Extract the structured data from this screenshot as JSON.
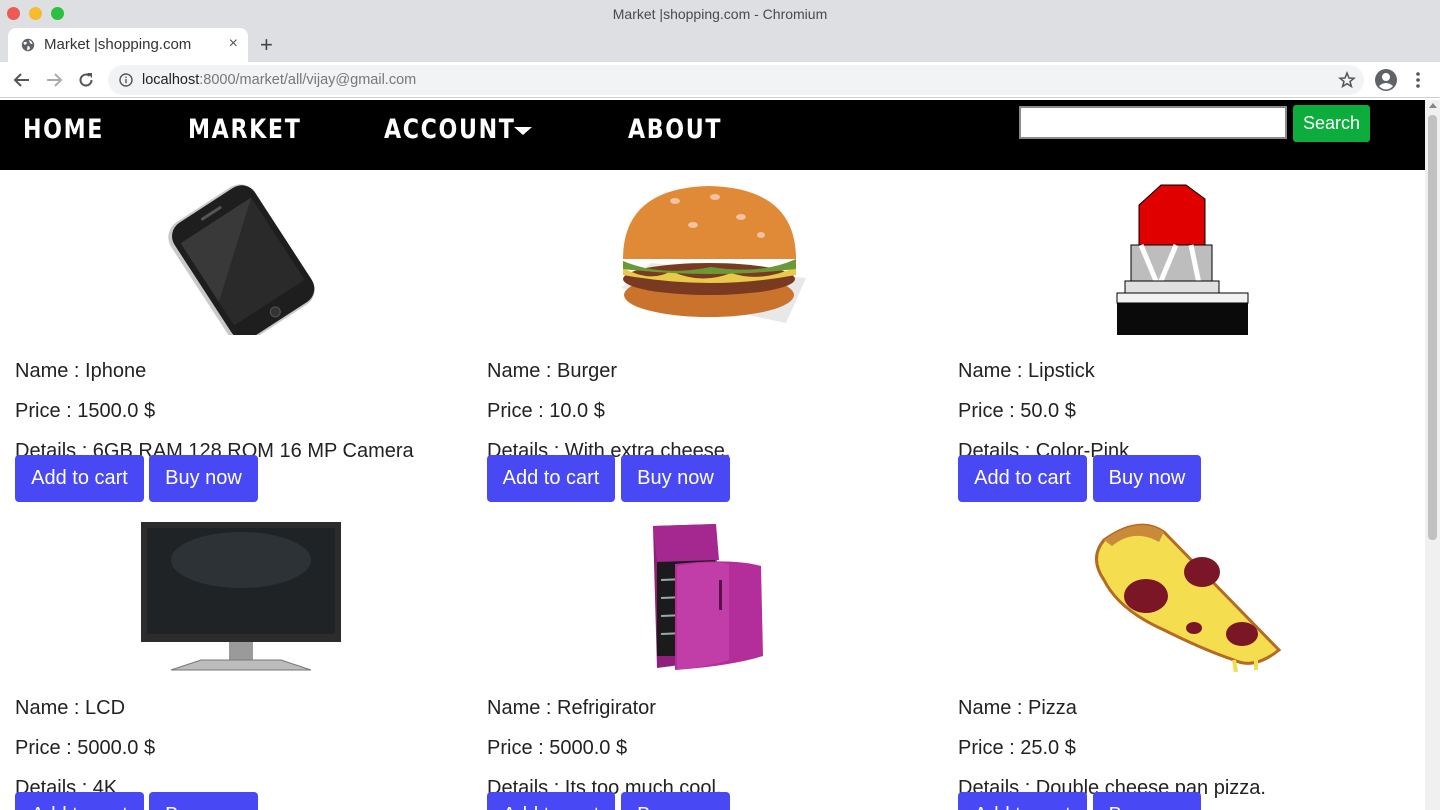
{
  "window": {
    "title": "Market |shopping.com - Chromium"
  },
  "tab": {
    "title": "Market |shopping.com",
    "close": "×",
    "new_tab": "+"
  },
  "address": {
    "host": "localhost",
    "path": ":8000/market/all/vijay@gmail.com"
  },
  "navbar": {
    "links": [
      "HOME",
      "MARKET",
      "ACCOUNT",
      "ABOUT"
    ],
    "search_value": "",
    "search_button": "Search"
  },
  "products": [
    {
      "name": "Name : Iphone",
      "price": "Price : 1500.0 $",
      "details": "Details : 6GB RAM 128 ROM 16 MP Camera",
      "add": "Add to cart",
      "buy": "Buy now"
    },
    {
      "name": "Name : Burger",
      "price": "Price : 10.0 $",
      "details": "Details : With extra cheese.",
      "add": "Add to cart",
      "buy": "Buy now"
    },
    {
      "name": "Name : Lipstick",
      "price": "Price : 50.0 $",
      "details": "Details : Color-Pink",
      "add": "Add to cart",
      "buy": "Buy now"
    },
    {
      "name": "Name : LCD",
      "price": "Price : 5000.0 $",
      "details": "Details : 4K",
      "add": "Add to cart",
      "buy": "Buy now"
    },
    {
      "name": "Name : Refrigirator",
      "price": "Price : 5000.0 $",
      "details": "Details : Its too much cool.",
      "add": "Add to cart",
      "buy": "Buy now"
    },
    {
      "name": "Name : Pizza",
      "price": "Price : 25.0 $",
      "details": "Details : Double cheese pan pizza.",
      "add": "Add to cart",
      "buy": "Buy now"
    }
  ],
  "colors": {
    "navbar": "#000000",
    "search_button": "#0cad3d",
    "action_button": "#4848f5"
  }
}
